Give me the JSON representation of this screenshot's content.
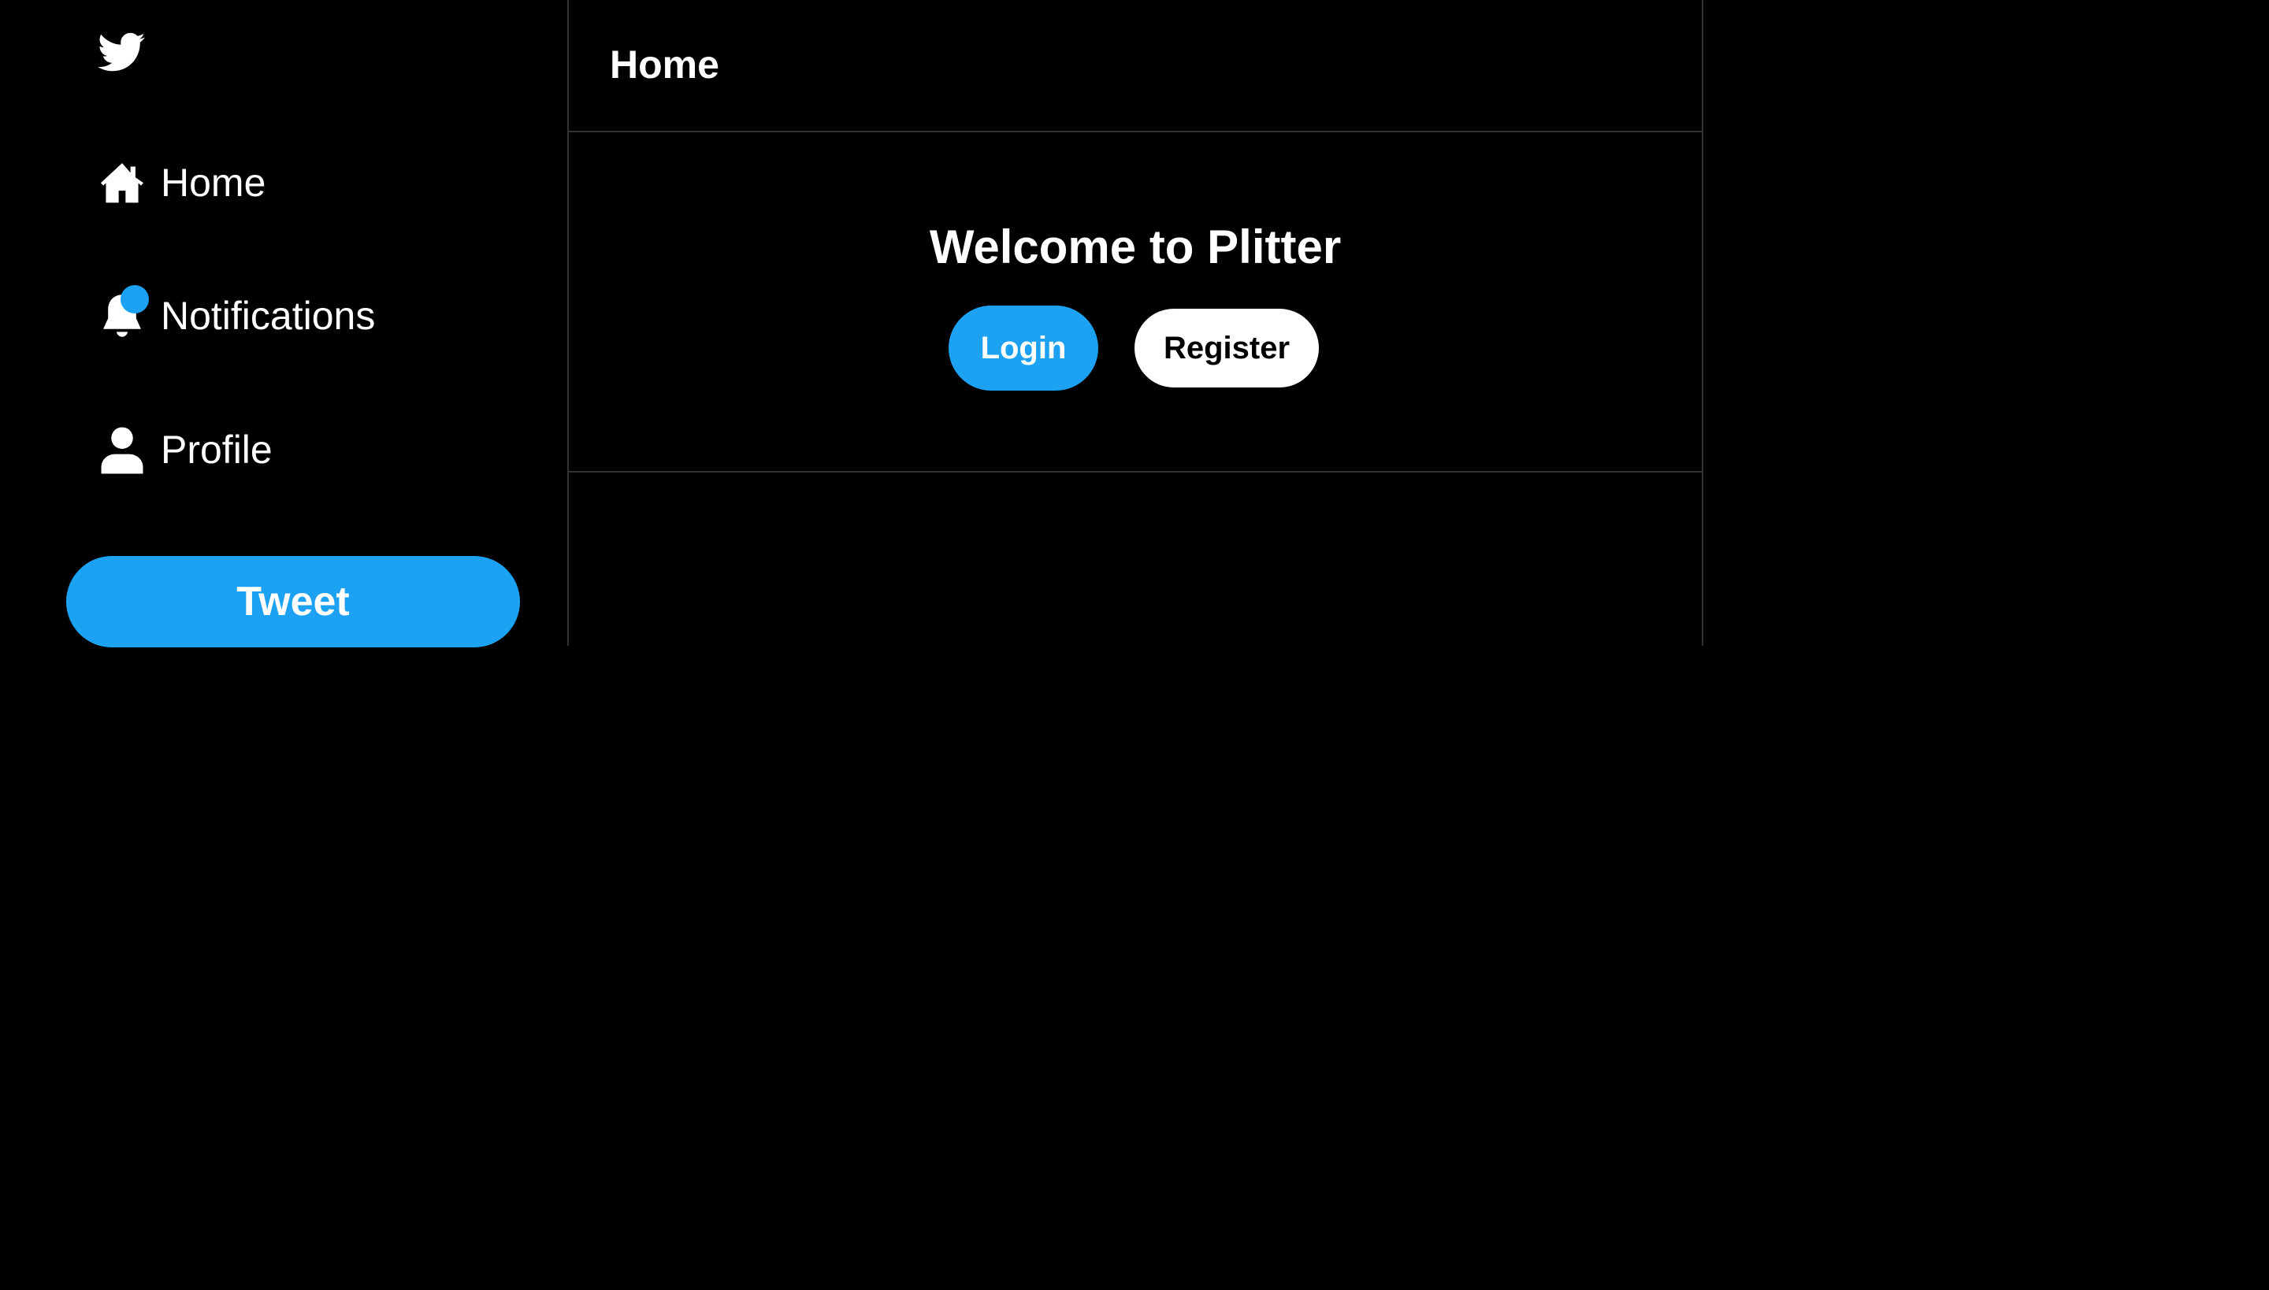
{
  "sidebar": {
    "logo_icon": "bird-logo-icon",
    "items": [
      {
        "label": "Home",
        "icon": "home-icon"
      },
      {
        "label": "Notifications",
        "icon": "bell-icon",
        "has_badge": true
      },
      {
        "label": "Profile",
        "icon": "user-icon"
      }
    ],
    "tweet_label": "Tweet"
  },
  "main": {
    "title": "Home",
    "welcome": {
      "heading": "Welcome to Plitter",
      "login_label": "Login",
      "register_label": "Register"
    }
  },
  "colors": {
    "background": "#000000",
    "accent": "#1da1f2",
    "text": "#ffffff",
    "border": "#2f3336"
  }
}
